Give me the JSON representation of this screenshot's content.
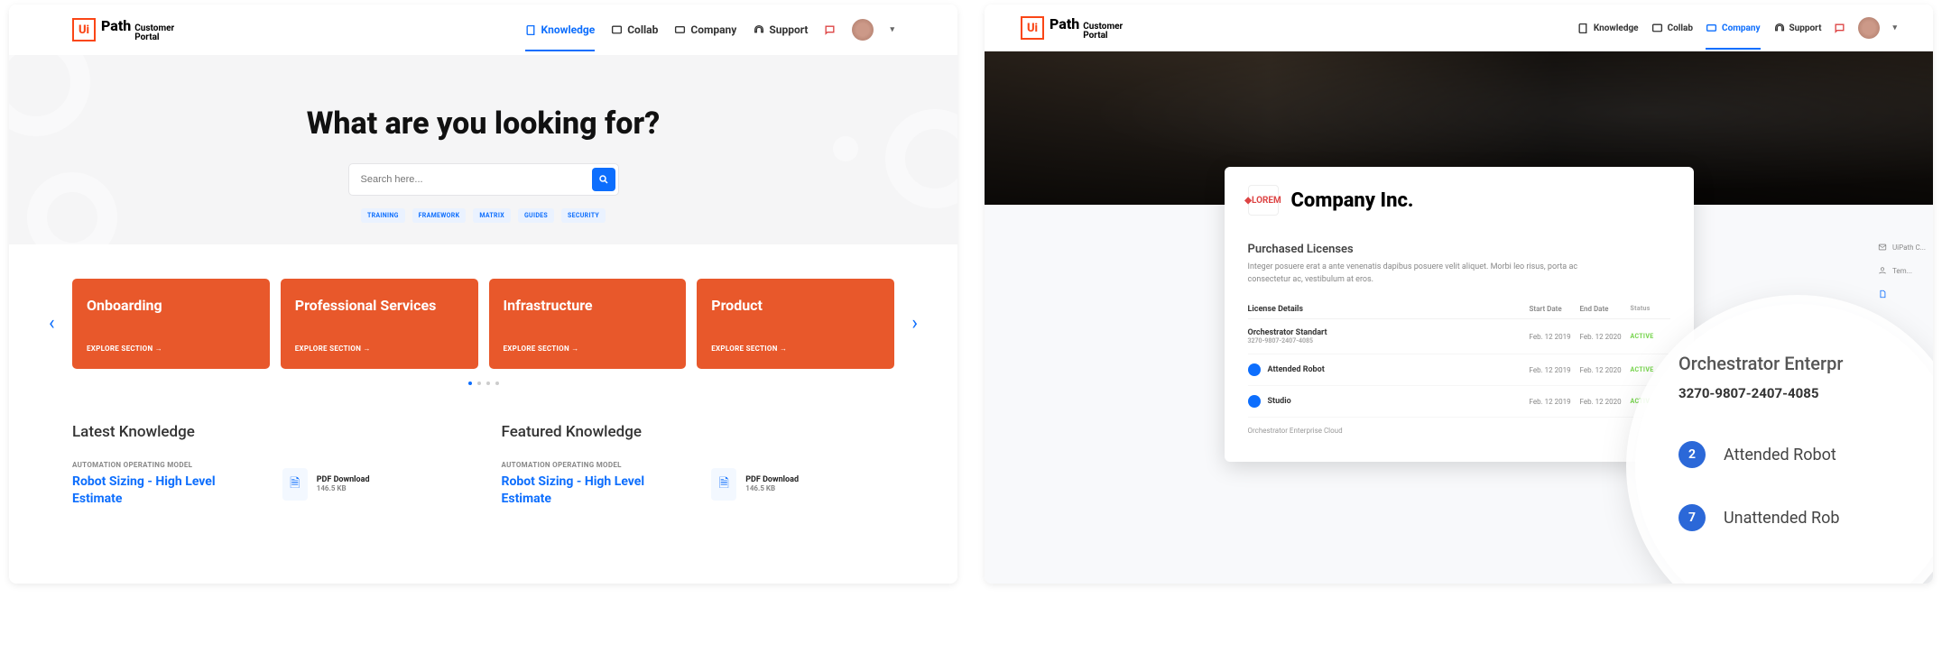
{
  "left": {
    "logo": {
      "brand": "Path",
      "prefix": "Ui",
      "sub1": "Customer",
      "sub2": "Portal"
    },
    "nav": [
      {
        "icon": "book-icon",
        "label": "Knowledge",
        "active": true
      },
      {
        "icon": "collab-icon",
        "label": "Collab",
        "active": false
      },
      {
        "icon": "company-icon",
        "label": "Company",
        "active": false
      },
      {
        "icon": "support-icon",
        "label": "Support",
        "active": false
      }
    ],
    "hero_title": "What are you looking for?",
    "search_placeholder": "Search here...",
    "tags": [
      "TRAINING",
      "FRAMEWORK",
      "MATRIX",
      "GUIDES",
      "SECURITY"
    ],
    "cards": [
      {
        "title": "Onboarding",
        "link": "EXPLORE SECTION →"
      },
      {
        "title": "Professional Services",
        "link": "EXPLORE SECTION →"
      },
      {
        "title": "Infrastructure",
        "link": "EXPLORE SECTION →"
      },
      {
        "title": "Product",
        "link": "EXPLORE SECTION →"
      }
    ],
    "latest_heading": "Latest Knowledge",
    "featured_heading": "Featured Knowledge",
    "latest": {
      "category": "AUTOMATION OPERATING MODEL",
      "title": "Robot Sizing - High Level Estimate",
      "dl_label": "PDF Download",
      "dl_size": "146.5 KB"
    },
    "featured": {
      "category": "AUTOMATION OPERATING MODEL",
      "title": "Robot Sizing - High Level Estimate",
      "dl_label": "PDF Download",
      "dl_size": "146.5 KB"
    }
  },
  "right": {
    "logo": {
      "brand": "Path",
      "prefix": "Ui",
      "sub1": "Customer",
      "sub2": "Portal"
    },
    "nav": [
      {
        "label": "Knowledge",
        "active": false
      },
      {
        "label": "Collab",
        "active": false
      },
      {
        "label": "Company",
        "active": true
      },
      {
        "label": "Support",
        "active": false
      }
    ],
    "company_logo_text": "LOREM",
    "company_name": "Company Inc.",
    "lic_heading": "Purchased Licenses",
    "lic_desc": "Integer posuere erat a ante venenatis dapibus posuere velit aliquet. Morbi leo risus, porta ac consectetur ac, vestibulum at eros.",
    "lic_cols": {
      "name": "License Details",
      "start": "Start Date",
      "end": "End Date",
      "status": "Status"
    },
    "lic_rows": [
      {
        "name": "Orchestrator Standart",
        "sub": "3270-9807-2407-4085",
        "start": "Feb. 12 2019",
        "end": "Feb. 12 2020",
        "status": "ACTIVE",
        "icon": false
      },
      {
        "name": "Attended Robot",
        "sub": "",
        "start": "Feb. 12 2019",
        "end": "Feb. 12 2020",
        "status": "ACTIVE",
        "icon": true
      },
      {
        "name": "Studio",
        "sub": "",
        "start": "Feb. 12 2019",
        "end": "Feb. 12 2020",
        "status": "ACTIVE",
        "icon": true
      }
    ],
    "lic_footer_row": "Orchestrator Enterprise Cloud",
    "side": [
      {
        "label": "UiPath C..."
      },
      {
        "label": "Tem..."
      },
      {
        "label": "",
        "active": true
      }
    ],
    "zoom": {
      "title": "Orchestrator Enterpr",
      "code": "3270-9807-2407-4085",
      "rows": [
        {
          "count": "2",
          "label": "Attended Robot"
        },
        {
          "count": "7",
          "label": "Unattended Rob"
        }
      ]
    }
  }
}
